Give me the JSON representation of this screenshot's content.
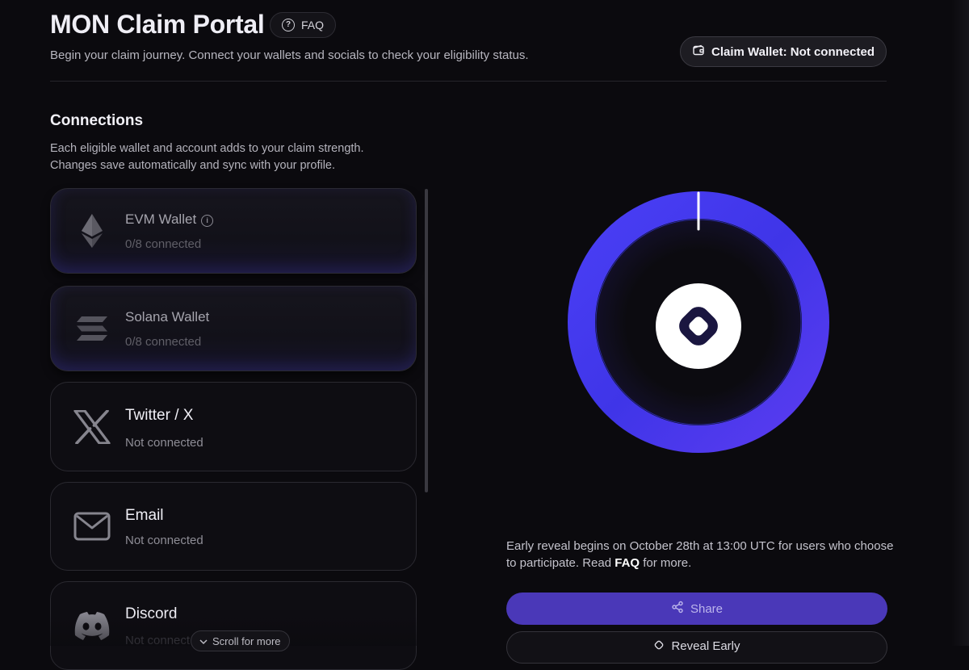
{
  "header": {
    "title": "MON Claim Portal",
    "faq_label": "FAQ",
    "subtitle": "Begin your claim journey. Connect your wallets and socials to check your eligibility status.",
    "wallet_button_label": "Claim Wallet: Not connected"
  },
  "connections": {
    "title": "Connections",
    "description_line1": "Each eligible wallet and account adds to your claim strength.",
    "description_line2": "Changes save automatically and sync with your profile.",
    "items": [
      {
        "name": "EVM Wallet",
        "status": "0/8 connected",
        "icon": "ethereum-icon"
      },
      {
        "name": "Solana Wallet",
        "status": "0/8 connected",
        "icon": "solana-icon"
      },
      {
        "name": "Twitter / X",
        "status": "Not connected",
        "icon": "x-logo-icon"
      },
      {
        "name": "Email",
        "status": "Not connected",
        "icon": "mail-icon"
      },
      {
        "name": "Discord",
        "status": "Not connect",
        "icon": "discord-icon"
      }
    ],
    "scroll_hint": "Scroll for more"
  },
  "reveal": {
    "text_before": "Early reveal begins on October 28th at 13:00 UTC for users who choose to participate. Read ",
    "text_link": "FAQ",
    "text_after": " for more.",
    "share_label": "Share",
    "reveal_label": "Reveal Early"
  },
  "colors": {
    "background": "#0b0a0e",
    "accent": "#4a38b8",
    "ring": "#4b36f0"
  }
}
